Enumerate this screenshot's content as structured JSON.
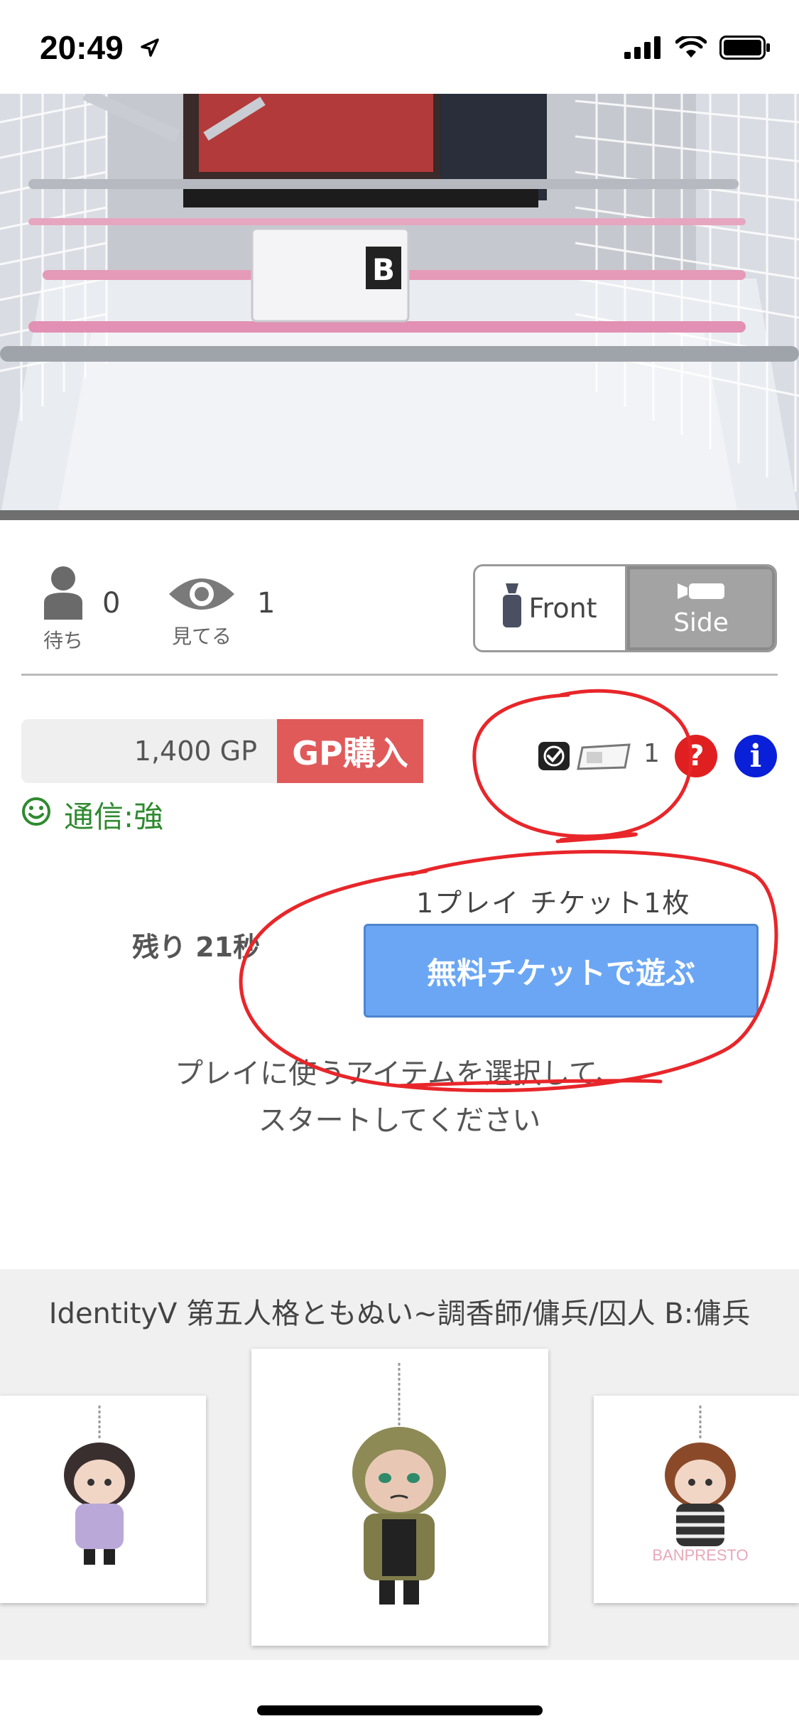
{
  "status_bar": {
    "time": "20:49"
  },
  "stats": {
    "waiting_label": "待ち",
    "waiting_count": "0",
    "watching_label": "見てる",
    "watching_count": "1"
  },
  "view_toggle": {
    "front_label": "Front",
    "side_label": "Side"
  },
  "gp": {
    "balance": "1,400 GP",
    "buy_label": "GP購入"
  },
  "connection": {
    "label": "通信:強"
  },
  "ticket": {
    "count": "1",
    "help": "?",
    "info": "i"
  },
  "play": {
    "note": "1プレイ チケット1枚",
    "remaining": "残り 21秒",
    "button_label": "無料チケットで遊ぶ",
    "instruction_line1": "プレイに使うアイテムを選択して、",
    "instruction_line2": "スタートしてください"
  },
  "product": {
    "title": "IdentityV 第五人格ともぬい~調香師/傭兵/囚人 B:傭兵",
    "watermark": "BANPRESTO"
  },
  "colors": {
    "gp_buy": "#e05a5a",
    "play_button": "#6aa6f3",
    "connection": "#2f8a2f",
    "help_icon": "#e02020",
    "info_icon": "#0a1fd8",
    "annotation": "#e8262a"
  },
  "icons": [
    "location-arrow-icon",
    "signal-icon",
    "wifi-icon",
    "battery-icon",
    "person-icon",
    "eye-icon",
    "camera-front-icon",
    "camera-side-icon",
    "smiley-icon",
    "checkbox-icon",
    "ticket-icon",
    "help-icon",
    "info-icon"
  ]
}
